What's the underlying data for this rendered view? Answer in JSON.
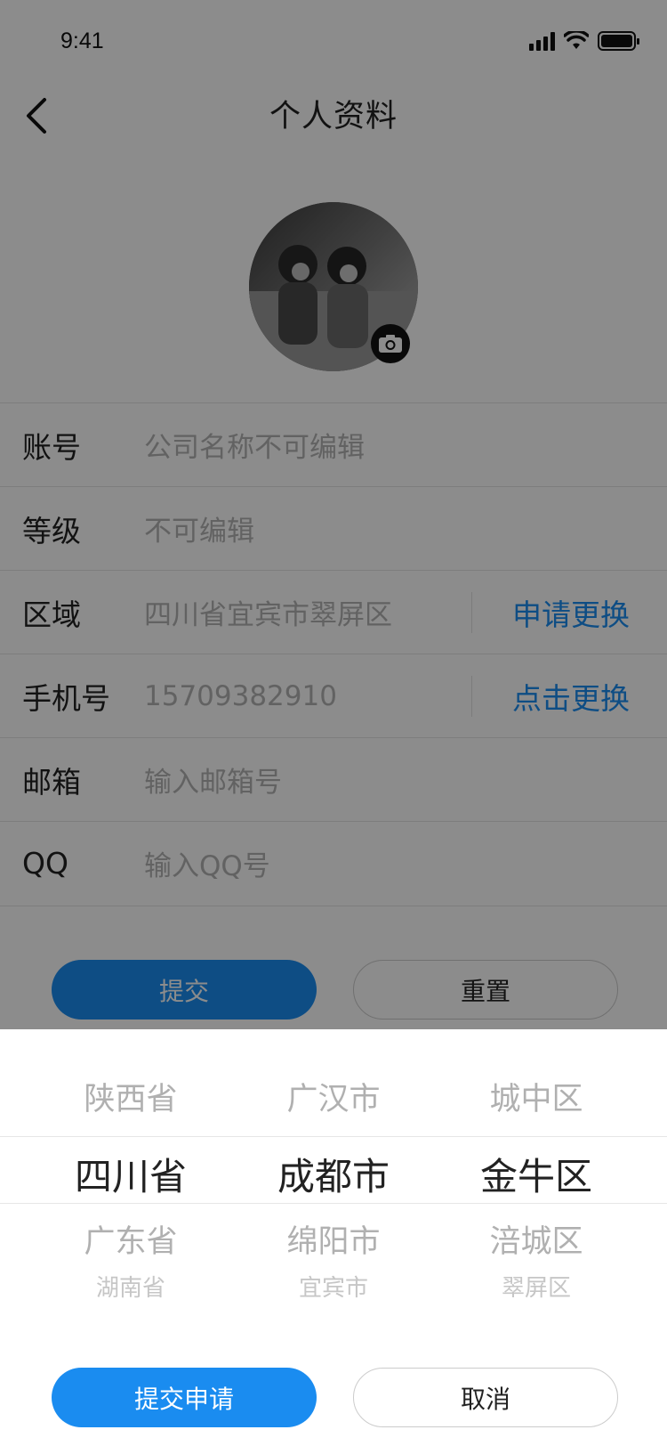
{
  "status_bar": {
    "time": "9:41"
  },
  "header": {
    "title": "个人资料"
  },
  "form": {
    "rows": [
      {
        "label": "账号",
        "value": "公司名称不可编辑"
      },
      {
        "label": "等级",
        "value": "不可编辑"
      },
      {
        "label": "区域",
        "value": "四川省宜宾市翠屏区",
        "action": "申请更换"
      },
      {
        "label": "手机号",
        "value": "15709382910",
        "action": "点击更换"
      },
      {
        "label": "邮箱",
        "placeholder": "输入邮箱号"
      },
      {
        "label": "QQ",
        "placeholder": "输入QQ号"
      }
    ],
    "submit_label": "提交",
    "reset_label": "重置"
  },
  "picker": {
    "provinces": [
      "陕西省",
      "四川省",
      "广东省",
      "湖南省"
    ],
    "cities": [
      "广汉市",
      "成都市",
      "绵阳市",
      "宜宾市"
    ],
    "districts": [
      "城中区",
      "金牛区",
      "涪城区",
      "翠屏区"
    ],
    "apply_label": "提交申请",
    "cancel_label": "取消"
  },
  "colors": {
    "accent": "#1a8cf0",
    "overlay": "rgba(0,0,0,0.45)"
  }
}
